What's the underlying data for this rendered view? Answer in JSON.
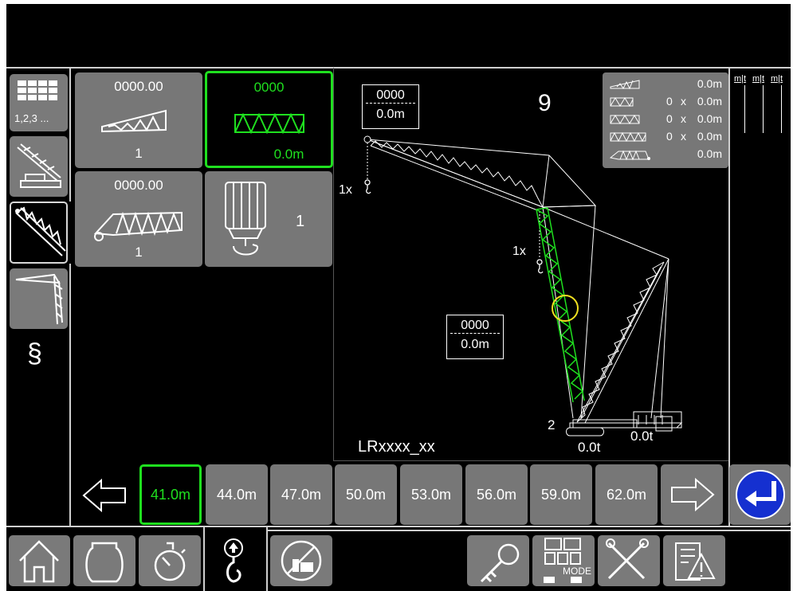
{
  "colors": {
    "accent_green": "#1fe01f",
    "tile_gray": "#777777",
    "highlight_yellow": "#f0e020",
    "return_blue": "#1530d0"
  },
  "left_tabs": [
    {
      "icon": "configuration-grid-icon",
      "label": "1,2,3 ..."
    },
    {
      "icon": "crawler-crane-icon"
    },
    {
      "icon": "main-boom-icon",
      "selected": true
    },
    {
      "icon": "luffing-jib-icon"
    },
    {
      "icon": "paragraph-icon",
      "glyph": "§"
    }
  ],
  "tiles": {
    "main_boom": {
      "value": "0000.00",
      "count": "1"
    },
    "intermediate": {
      "value": "0000",
      "length": "0.0m"
    },
    "pivot_section": {
      "value": "0000.00",
      "count": "1"
    },
    "hook_block": {
      "count": "1"
    }
  },
  "diagram": {
    "model": "LRxxxx_xx",
    "top_label": {
      "line1": "0000",
      "line2": "0.0m"
    },
    "mid_label": {
      "line1": "0000",
      "line2": "0.0m"
    },
    "hook_top": "1x",
    "hook_mid": "1x",
    "tip_number": "9",
    "base_number": "2",
    "load_left": "0.0t",
    "load_right": "0.0t",
    "summary": [
      {
        "icon": "tip-section-icon",
        "count": "",
        "x": "",
        "length": "0.0m"
      },
      {
        "icon": "lattice-3m-icon",
        "count": "0",
        "x": "x",
        "length": "0.0m"
      },
      {
        "icon": "lattice-6m-icon",
        "count": "0",
        "x": "x",
        "length": "0.0m"
      },
      {
        "icon": "lattice-12m-icon",
        "count": "0",
        "x": "x",
        "length": "0.0m"
      },
      {
        "icon": "foot-section-icon",
        "count": "",
        "x": "",
        "length": "0.0m"
      }
    ]
  },
  "right_header": [
    "m|t",
    "m|t",
    "m|t"
  ],
  "length_selector": {
    "selected": "41.0m",
    "options": [
      "41.0m",
      "44.0m",
      "47.0m",
      "50.0m",
      "53.0m",
      "56.0m",
      "59.0m",
      "62.0m"
    ]
  },
  "bottom_bar": {
    "mode_label": "MODE",
    "buttons": [
      "home-icon",
      "engine-icon",
      "stopwatch-icon",
      "hook-up-icon",
      "no-counterweight-icon",
      "key-icon",
      "mode-icon",
      "tools-icon",
      "warning-document-icon"
    ]
  }
}
